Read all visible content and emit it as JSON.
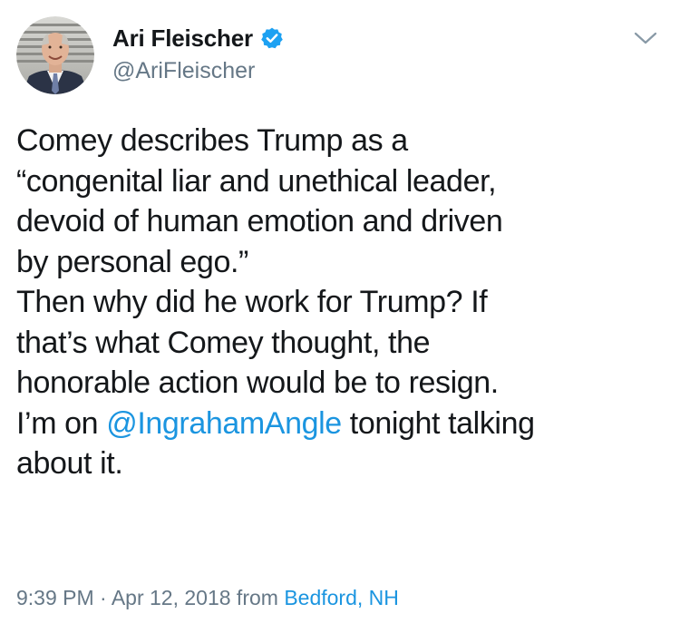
{
  "author": {
    "display_name": "Ari Fleischer",
    "handle": "@AriFleischer",
    "verified": true
  },
  "tweet": {
    "lines": [
      "Comey describes Trump as a",
      "“congenital liar and unethical leader,",
      "devoid of human emotion and driven",
      "by personal ego.”",
      "Then why did he work for Trump?  If",
      "that’s what Comey thought, the",
      "honorable action would be to resign."
    ],
    "mention_line": {
      "prefix": "I’m on ",
      "mention": "@IngrahamAngle",
      "suffix": " tonight talking"
    },
    "last_line": "about it."
  },
  "meta": {
    "time": "9:39 PM",
    "separator": " · ",
    "date": "Apr 12, 2018",
    "from_label": " from ",
    "location": "Bedford, NH"
  },
  "colors": {
    "link": "#1b95e0",
    "verified": "#1da1f2",
    "secondary_text": "#657786",
    "primary_text": "#14171a"
  },
  "icons": {
    "verified": "verified-badge-icon",
    "menu": "chevron-down-icon"
  }
}
